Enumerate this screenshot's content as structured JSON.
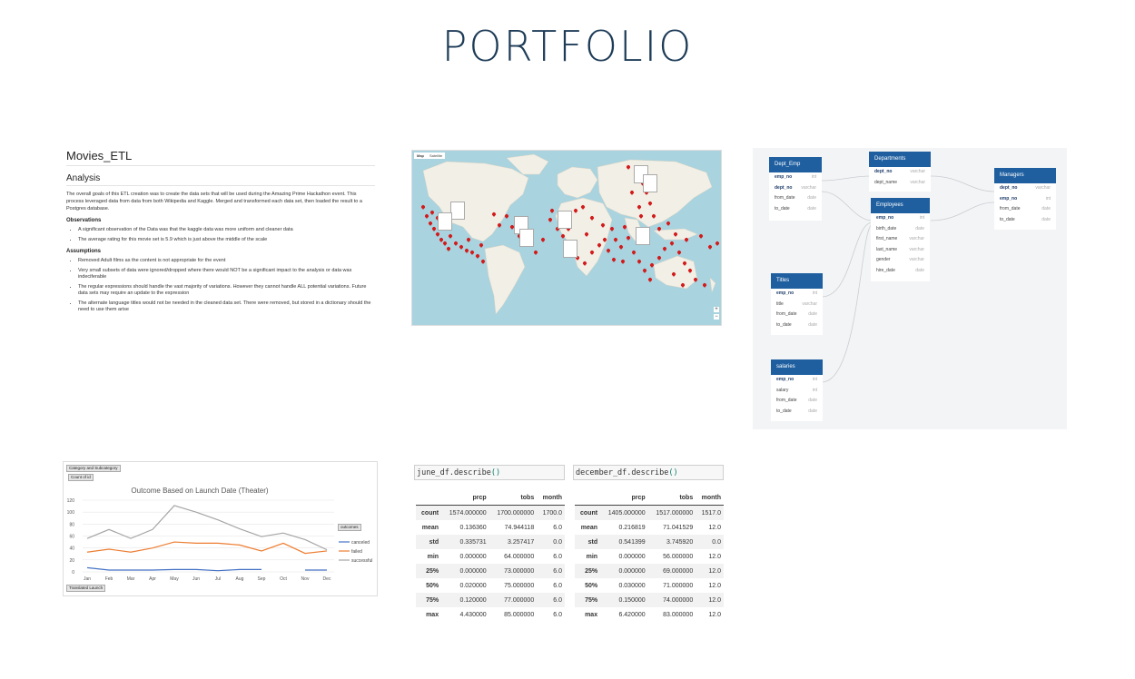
{
  "page": {
    "title": "PORTFOLIO"
  },
  "etl": {
    "title": "Movies_ETL",
    "section": "Analysis",
    "intro": "The overall goals of this ETL creation was to create the data sets that will be used during the Amazing Prime Hackathon event. This process leveraged data from data from both Wikipedia and Kaggle. Merged and transformed each data set, then loaded the result to a Postgres database.",
    "observations_heading": "Observations",
    "observations": [
      "A significant observation of the Data was that the kaggle data was more uniform and cleaner data",
      "The average rating for this movie set is 5.9 which is just above the middle of the scale"
    ],
    "assumptions_heading": "Assumptions",
    "assumptions": [
      "Removed Adult films as the content is not appropriate for the event",
      "Very small subsets of data were ignored/dropped where there would NOT be a significant impact to the analysis or data was indeciferable",
      "The regular expressions should handle the vast majority of variations. However they cannot handle ALL potential variations. Future data sets may require an update to the expression",
      "The alternate language titles would not be needed in the cleaned data set. There were removed, but stored in a dictionary should the need to use them arise"
    ]
  },
  "map": {
    "tab_map": "Map",
    "tab_satellite": "Satellite",
    "zoom_in": "+",
    "zoom_out": "−"
  },
  "erd": {
    "tables": [
      {
        "name": "Dept_Emp",
        "fields": [
          [
            "emp_no",
            "int"
          ],
          [
            "dept_no",
            "varchar"
          ],
          [
            "from_date",
            "date"
          ],
          [
            "to_date",
            "date"
          ]
        ]
      },
      {
        "name": "Departments",
        "fields": [
          [
            "dept_no",
            "varchar"
          ],
          [
            "dept_name",
            "varchar"
          ]
        ]
      },
      {
        "name": "Employees",
        "fields": [
          [
            "emp_no",
            "int"
          ],
          [
            "birth_date",
            "date"
          ],
          [
            "first_name",
            "varchar"
          ],
          [
            "last_name",
            "varchar"
          ],
          [
            "gender",
            "varchar"
          ],
          [
            "hire_date",
            "date"
          ]
        ]
      },
      {
        "name": "Managers",
        "fields": [
          [
            "dept_no",
            "varchar"
          ],
          [
            "emp_no",
            "int"
          ],
          [
            "from_date",
            "date"
          ],
          [
            "to_date",
            "date"
          ]
        ]
      },
      {
        "name": "Titles",
        "fields": [
          [
            "emp_no",
            "int"
          ],
          [
            "title",
            "varchar"
          ],
          [
            "from_date",
            "date"
          ],
          [
            "to_date",
            "date"
          ]
        ]
      },
      {
        "name": "salaries",
        "fields": [
          [
            "emp_no",
            "int"
          ],
          [
            "salary",
            "int"
          ],
          [
            "from_date",
            "date"
          ],
          [
            "to_date",
            "date"
          ]
        ]
      }
    ]
  },
  "excel": {
    "filter_btn": "Category and Subcategory",
    "count_btn": "Count of id",
    "axis_btn": "Translated Launch",
    "legend_btn": "outcomes"
  },
  "chart_data": {
    "type": "line",
    "title": "Outcome Based on Launch Date (Theater)",
    "categories": [
      "Jan",
      "Feb",
      "Mar",
      "Apr",
      "May",
      "Jun",
      "Jul",
      "Aug",
      "Sep",
      "Oct",
      "Nov",
      "Dec"
    ],
    "ylim": [
      0,
      120
    ],
    "yticks": [
      "0",
      "20",
      "40",
      "60",
      "80",
      "100",
      "120"
    ],
    "series": [
      {
        "name": "canceled",
        "color": "#4472c4",
        "values": [
          7,
          3,
          3,
          3,
          4,
          4,
          2,
          4,
          4,
          null,
          3,
          3
        ]
      },
      {
        "name": "failed",
        "color": "#ed7d31",
        "values": [
          33,
          38,
          33,
          40,
          50,
          48,
          48,
          45,
          35,
          48,
          31,
          35
        ]
      },
      {
        "name": "successful",
        "color": "#a5a5a5",
        "values": [
          56,
          71,
          56,
          71,
          111,
          100,
          87,
          72,
          59,
          65,
          54,
          37
        ]
      }
    ],
    "legend": "right"
  },
  "df_june": {
    "code_fn": "june_df.describe",
    "code_paren": "()",
    "columns": [
      "prcp",
      "tobs",
      "month"
    ],
    "rows": [
      [
        "count",
        "1574.000000",
        "1700.000000",
        "1700.0"
      ],
      [
        "mean",
        "0.136360",
        "74.944118",
        "6.0"
      ],
      [
        "std",
        "0.335731",
        "3.257417",
        "0.0"
      ],
      [
        "min",
        "0.000000",
        "64.000000",
        "6.0"
      ],
      [
        "25%",
        "0.000000",
        "73.000000",
        "6.0"
      ],
      [
        "50%",
        "0.020000",
        "75.000000",
        "6.0"
      ],
      [
        "75%",
        "0.120000",
        "77.000000",
        "6.0"
      ],
      [
        "max",
        "4.430000",
        "85.000000",
        "6.0"
      ]
    ]
  },
  "df_dec": {
    "code_fn": "december_df.describe",
    "code_paren": "()",
    "columns": [
      "prcp",
      "tobs",
      "month"
    ],
    "rows": [
      [
        "count",
        "1405.000000",
        "1517.000000",
        "1517.0"
      ],
      [
        "mean",
        "0.216819",
        "71.041529",
        "12.0"
      ],
      [
        "std",
        "0.541399",
        "3.745920",
        "0.0"
      ],
      [
        "min",
        "0.000000",
        "56.000000",
        "12.0"
      ],
      [
        "25%",
        "0.000000",
        "69.000000",
        "12.0"
      ],
      [
        "50%",
        "0.030000",
        "71.000000",
        "12.0"
      ],
      [
        "75%",
        "0.150000",
        "74.000000",
        "12.0"
      ],
      [
        "max",
        "6.420000",
        "83.000000",
        "12.0"
      ]
    ]
  }
}
